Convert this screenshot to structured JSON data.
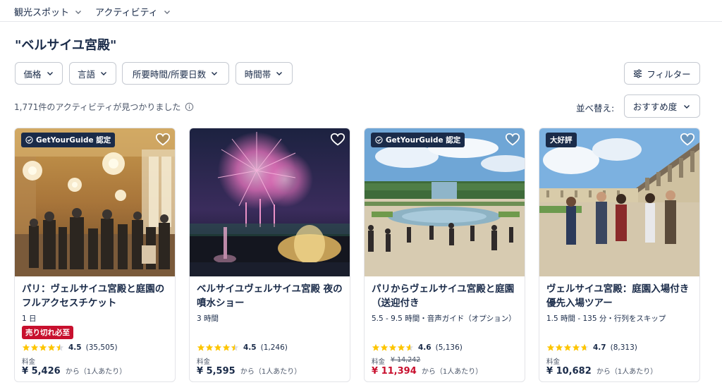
{
  "nav": {
    "items": [
      "観光スポット",
      "アクティビティ"
    ]
  },
  "page_title": "\"ベルサイユ宮殿\"",
  "filters": {
    "price": "価格",
    "language": "言語",
    "duration": "所要時間/所要日数",
    "time_of_day": "時間帯",
    "filter_button": "フィルター"
  },
  "results": {
    "count_text": "1,771件のアクティビティが見つかりました",
    "sort_label": "並べ替え:",
    "sort_value": "おすすめ度"
  },
  "cards": [
    {
      "badge": "GetYourGuide 認定",
      "title": "パリ：ヴェルサイユ宮殿と庭園のフルアクセスチケット",
      "meta": "1 日",
      "urgency_badge": "売り切れ必至",
      "rating": "4.5",
      "reviews": "(35,505)",
      "price_label": "料金",
      "price": "¥ 5,426",
      "price_suffix": "から（1人あたり）"
    },
    {
      "title": "ベルサイユヴェルサイユ宮殿 夜の噴水ショー",
      "meta": "3 時間",
      "rating": "4.5",
      "reviews": "(1,246)",
      "price_label": "料金",
      "price": "¥ 5,595",
      "price_suffix": "から（1人あたり）"
    },
    {
      "badge": "GetYourGuide 認定",
      "title": "パリからヴェルサイユ宮殿と庭園（送迎付き",
      "meta": "5.5 - 9.5 時間・音声ガイド（オプション）",
      "rating": "4.6",
      "reviews": "(5,136)",
      "price_label": "料金",
      "original_price": "¥ 14,242",
      "price": "¥ 11,394",
      "price_suffix": "から（1人あたり）"
    },
    {
      "badge": "大好評",
      "title": "ヴェルサイユ宮殿：庭園入場付き優先入場ツアー",
      "meta": "1.5 時間 - 135 分・行列をスキップ",
      "rating": "4.7",
      "reviews": "(8,313)",
      "price_label": "料金",
      "price": "¥ 10,682",
      "price_suffix": "から（1人あたり）"
    }
  ],
  "colors": {
    "primary_text": "#1a2b49",
    "badge_bg": "#1a2b49",
    "sale_red": "#c8102e",
    "star": "#fdc500",
    "border": "#c5c9d1"
  },
  "icons": [
    "chevron-down-icon",
    "filter-sliders-icon",
    "info-icon",
    "heart-icon",
    "verified-check-icon",
    "star-icon"
  ]
}
